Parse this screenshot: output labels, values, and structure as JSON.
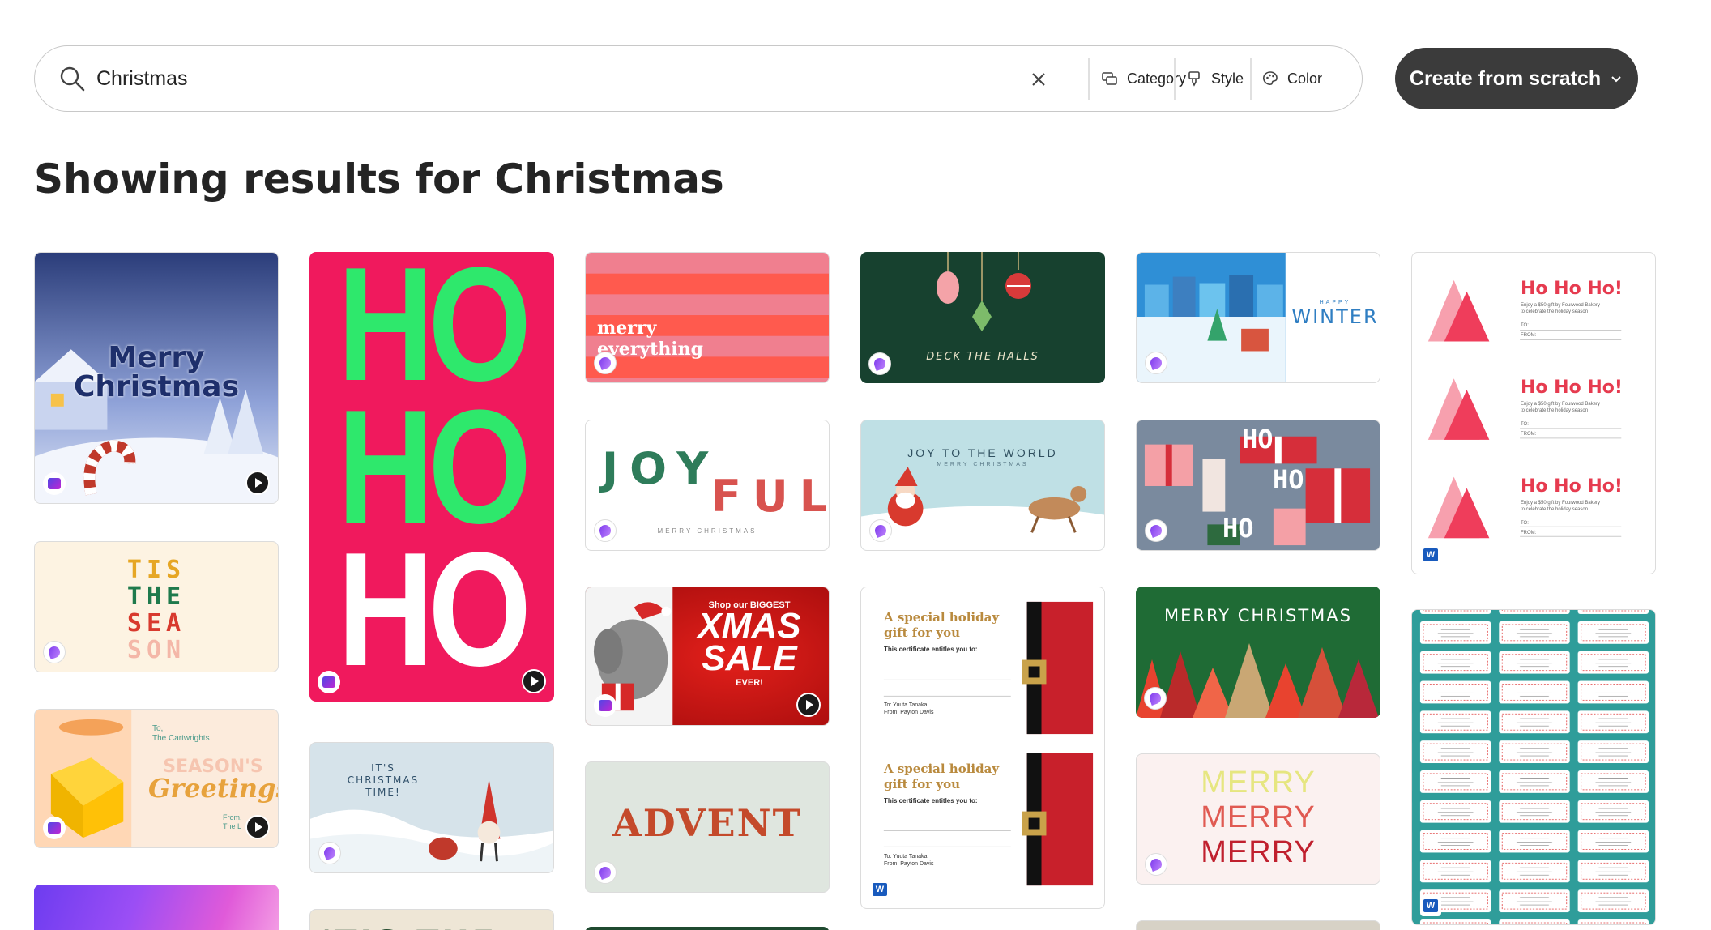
{
  "search": {
    "query": "Christmas",
    "clear_label": "Clear search",
    "filters": {
      "category": "Category",
      "style": "Style",
      "color": "Color"
    }
  },
  "create_button": {
    "label": "Create from scratch"
  },
  "results": {
    "prefix": "Showing results for",
    "term": "Christmas"
  },
  "cards": {
    "merry_christmas_video": {
      "text": "Merry Christmas"
    },
    "tis_the_season": {
      "lines": [
        "TIS",
        "THE",
        "SEA",
        "SON"
      ]
    },
    "seasons_greetings": {
      "to": "To,",
      "name": "The Cartwrights",
      "line1": "SEASON'S",
      "line2": "Greetings",
      "from": "From,",
      "from_name": "The L"
    },
    "hohoho_tall": {
      "lines": [
        "HO",
        "HO",
        "HO"
      ]
    },
    "its_christmas_time": {
      "lines": [
        "IT'S",
        "CHRISTMAS",
        "TIME!"
      ]
    },
    "merry_everything": {
      "line1": "merry",
      "line2": "everything"
    },
    "joyful": {
      "part1": "JOY",
      "part2": "FUL",
      "sub": "MERRY CHRISTMAS"
    },
    "xmas_sale": {
      "shop": "Shop our BIGGEST",
      "big1": "XMAS",
      "big2": "SALE",
      "ever": "EVER!"
    },
    "advent": {
      "text": "ADVENT"
    },
    "deck_the_halls": {
      "text": "DECK THE HALLS"
    },
    "joy_to_the_world": {
      "title": "JOY TO THE WORLD",
      "sub": "MERRY CHRISTMAS"
    },
    "holiday_gift": {
      "title1": "A special holiday",
      "title2": "gift for you",
      "entitles": "This certificate entitles you to:",
      "to": "To: Yuuta Tanaka",
      "from": "From: Payton Davis"
    },
    "happy_winter": {
      "small": "HAPPY",
      "big": "WINTER"
    },
    "ho_gifts": {
      "lines": [
        "HO",
        "HO",
        "HO"
      ]
    },
    "merry_christmas_trees": {
      "text": "MERRY CHRISTMAS"
    },
    "merry_merry_merry": {
      "lines": [
        "MERRY",
        "MERRY",
        "MERRY"
      ]
    },
    "ho_ho_ho_cards": {
      "title": "Ho Ho Ho!",
      "body1": "Enjoy a $50 gift by Fourwood Bakery",
      "body2": "to celebrate the holiday season",
      "to": "TO:",
      "from": "FROM:"
    }
  },
  "colors": {
    "create_button_bg": "#3b3b3b",
    "hohoho_bg": "#f0195d",
    "hohoho_green": "#2ee86c"
  }
}
